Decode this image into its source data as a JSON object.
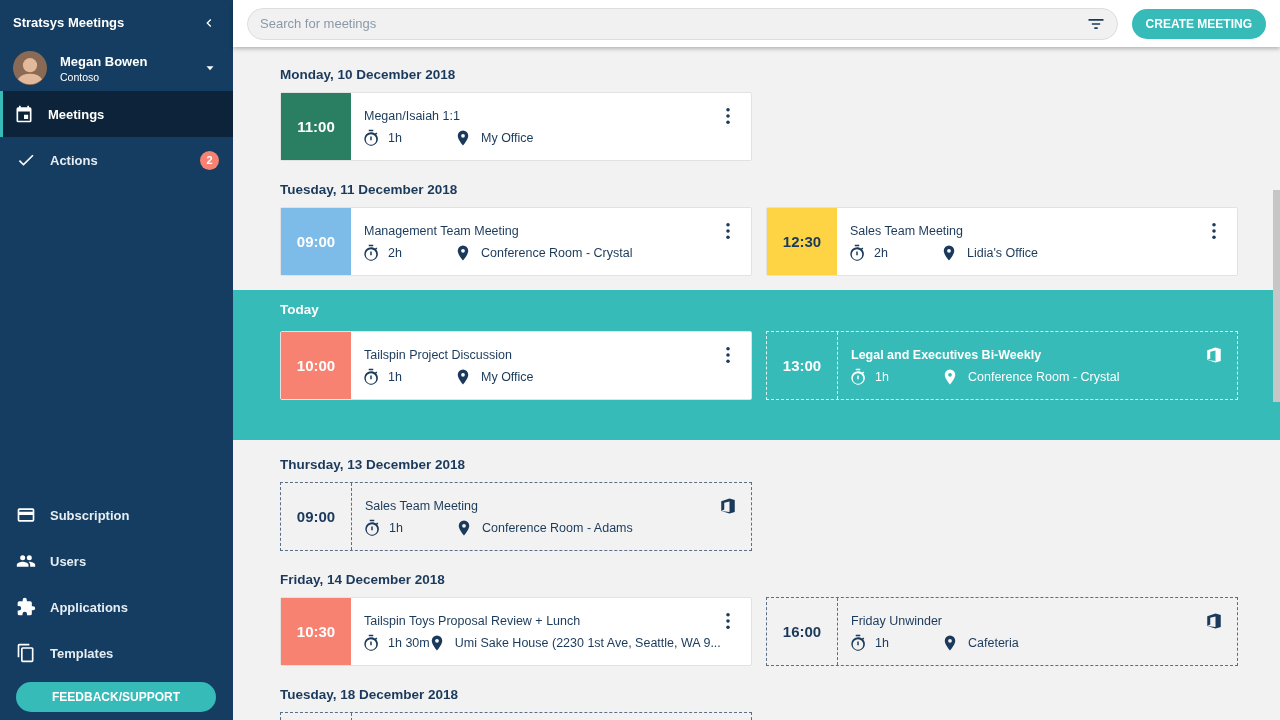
{
  "sidebar": {
    "app_title": "Stratsys Meetings",
    "user": {
      "name": "Megan Bowen",
      "org": "Contoso"
    },
    "nav_top": [
      {
        "label": "Meetings",
        "selected": true
      },
      {
        "label": "Actions",
        "selected": false,
        "badge": "2"
      }
    ],
    "nav_bottom": [
      {
        "label": "Subscription",
        "selected": false
      },
      {
        "label": "Users",
        "selected": false
      },
      {
        "label": "Applications",
        "selected": false
      },
      {
        "label": "Templates",
        "selected": false
      }
    ],
    "feedback_button": "FEEDBACK/SUPPORT"
  },
  "search": {
    "placeholder": "Search for meetings"
  },
  "create_button": "CREATE MEETING",
  "days": [
    {
      "label": "Monday, 10 December 2018",
      "today": false,
      "meetings": [
        {
          "kind": "app",
          "time": "11:00",
          "color": "#2a7f62",
          "title": "Megan/Isaiah 1:1",
          "duration": "1h",
          "location": "My Office"
        }
      ]
    },
    {
      "label": "Tuesday, 11 December 2018",
      "today": false,
      "meetings": [
        {
          "kind": "app",
          "time": "09:00",
          "color": "#7dbbe8",
          "title": "Management Team Meeting",
          "duration": "2h",
          "location": "Conference Room - Crystal"
        },
        {
          "kind": "app",
          "time": "12:30",
          "color": "#ffd444",
          "title": "Sales Team Meeting",
          "duration": "2h",
          "location": "Lidia's Office"
        }
      ]
    },
    {
      "label": "Today",
      "today": true,
      "meetings": [
        {
          "kind": "app",
          "time": "10:00",
          "color": "#f78272",
          "title": "Tailspin Project Discussion",
          "duration": "1h",
          "location": "My Office"
        },
        {
          "kind": "outlook",
          "time": "13:00",
          "title": "Legal and Executives Bi-Weekly",
          "duration": "1h",
          "location": "Conference Room - Crystal"
        }
      ]
    },
    {
      "label": "Thursday, 13 December 2018",
      "today": false,
      "meetings": [
        {
          "kind": "outlook",
          "time": "09:00",
          "title": "Sales Team Meeting",
          "duration": "1h",
          "location": "Conference Room - Adams"
        }
      ]
    },
    {
      "label": "Friday, 14 December 2018",
      "today": false,
      "meetings": [
        {
          "kind": "app",
          "time": "10:30",
          "color": "#f78272",
          "title": "Tailspin Toys Proposal Review + Lunch",
          "duration": "1h 30m",
          "location": "Umi Sake House (2230 1st Ave, Seattle, WA 9..."
        },
        {
          "kind": "outlook",
          "time": "16:00",
          "title": "Friday Unwinder",
          "duration": "1h",
          "location": "Cafeteria"
        }
      ]
    },
    {
      "label": "Tuesday, 18 December 2018",
      "today": false,
      "meetings": [
        {
          "kind": "outlook"
        }
      ]
    }
  ]
}
